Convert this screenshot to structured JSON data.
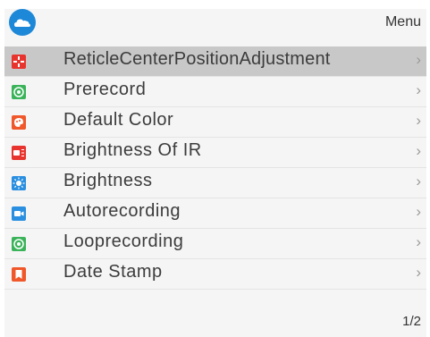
{
  "header": {
    "menu_label": "Menu",
    "cloud_icon": "cloud-icon"
  },
  "items": [
    {
      "label": "ReticleCenterPositionAdjustment",
      "icon": "crosshair-icon",
      "color": "#e8342f",
      "selected": true
    },
    {
      "label": "Prerecord",
      "icon": "record-target-icon",
      "color": "#3bb35a",
      "selected": false
    },
    {
      "label": "Default Color",
      "icon": "palette-icon",
      "color": "#f0572a",
      "selected": false
    },
    {
      "label": "Brightness Of IR",
      "icon": "ir-light-icon",
      "color": "#e8342f",
      "selected": false
    },
    {
      "label": "Brightness",
      "icon": "sun-icon",
      "color": "#2a8fe0",
      "selected": false
    },
    {
      "label": "Autorecording",
      "icon": "video-camera-icon",
      "color": "#2a8fe0",
      "selected": false
    },
    {
      "label": "Looprecording",
      "icon": "loop-record-icon",
      "color": "#3bb35a",
      "selected": false
    },
    {
      "label": "Date Stamp",
      "icon": "bookmark-icon",
      "color": "#f0572a",
      "selected": false
    }
  ],
  "chevron": "›",
  "pager": "1/2"
}
